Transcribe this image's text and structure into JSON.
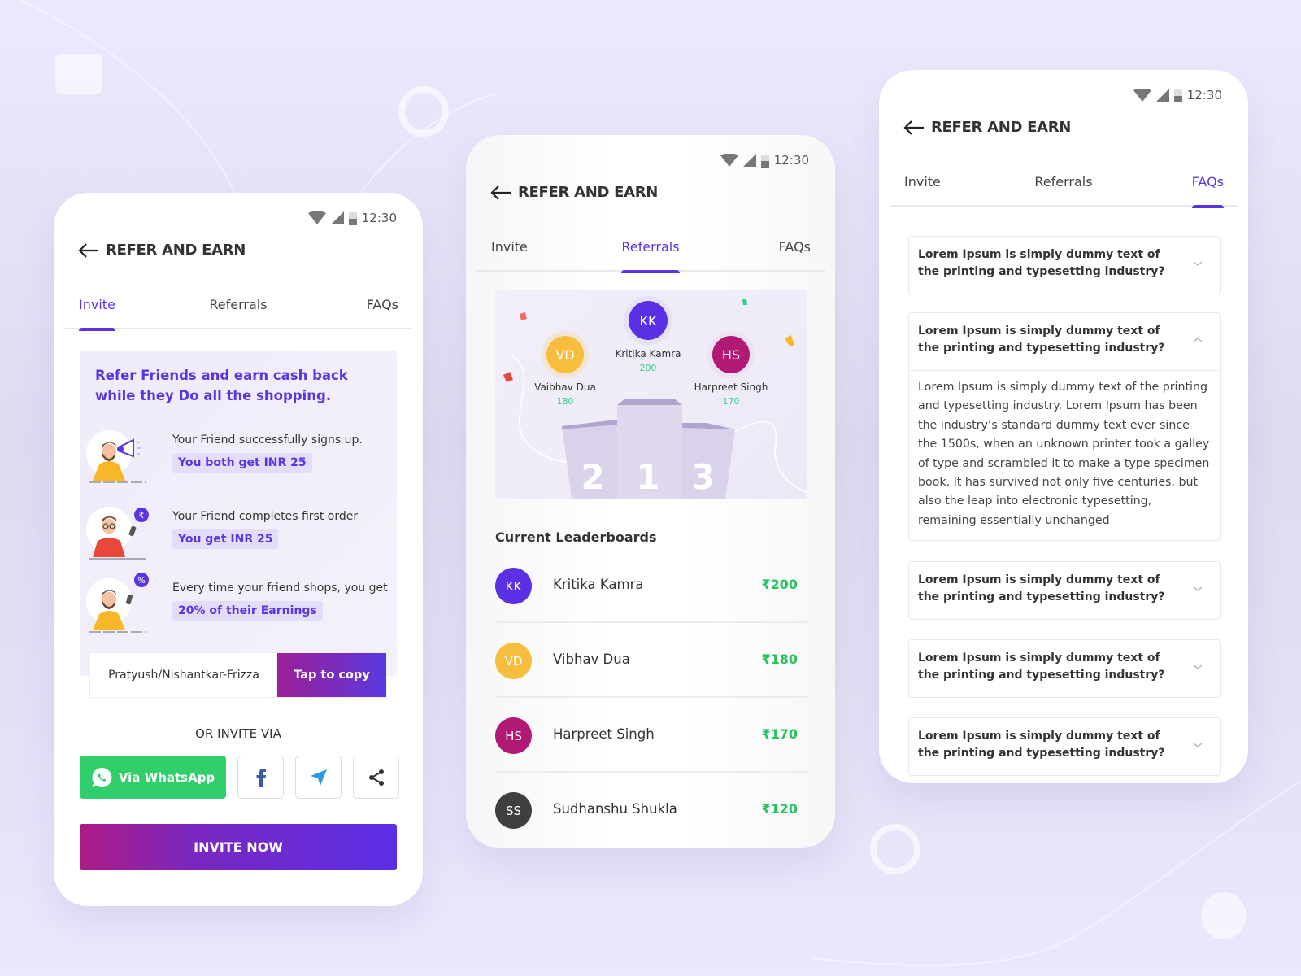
{
  "common": {
    "status_time": "12:30",
    "app_title": "REFER AND EARN",
    "tabs": [
      "Invite",
      "Referrals",
      "FAQs"
    ]
  },
  "colors": {
    "accent": "#5b34e3",
    "success": "#27c35c",
    "whatsapp": "#31cf6b"
  },
  "invite_screen": {
    "active_tab": "Invite",
    "headline": "Refer Friends and earn cash back while they Do all the shopping.",
    "steps": [
      {
        "text": "Your Friend successfully signs up.",
        "reward": "You both get INR 25",
        "icon": "megaphone-person-illustration"
      },
      {
        "text": "Your Friend completes first order",
        "reward": "You get INR 25",
        "icon": "rupee-person-illustration"
      },
      {
        "text": "Every time your friend shops, you get",
        "reward": "20% of their Earnings",
        "icon": "percent-person-illustration"
      }
    ],
    "referral_code": "Pratyush/Nishantkar-Frizza",
    "copy_label": "Tap to copy",
    "or_invite_label": "OR INVITE VIA",
    "whatsapp_label": "Via WhatsApp",
    "share_icons": [
      "facebook-icon",
      "telegram-icon",
      "share-icon"
    ],
    "invite_button": "INVITE NOW"
  },
  "referrals_screen": {
    "active_tab": "Referrals",
    "podium": [
      {
        "rank": "2",
        "initials": "VD",
        "name": "Vaibhav Dua",
        "score": "180",
        "color": "#f7bd3c"
      },
      {
        "rank": "1",
        "initials": "KK",
        "name": "Kritika Kamra",
        "score": "200",
        "color": "#5b2fe3"
      },
      {
        "rank": "3",
        "initials": "HS",
        "name": "Harpreet Singh",
        "score": "170",
        "color": "#b01a74"
      }
    ],
    "leaderboard_title": "Current Leaderboards",
    "leaderboard": [
      {
        "initials": "KK",
        "name": "Kritika Kamra",
        "amount": "₹200",
        "color": "#5b2fe3"
      },
      {
        "initials": "VD",
        "name": "Vibhav Dua",
        "amount": "₹180",
        "color": "#f7bd3c"
      },
      {
        "initials": "HS",
        "name": "Harpreet Singh",
        "amount": "₹170",
        "color": "#b01a74"
      },
      {
        "initials": "SS",
        "name": "Sudhanshu Shukla",
        "amount": "₹120",
        "color": "#3f3f3f"
      }
    ]
  },
  "faqs_screen": {
    "active_tab": "FAQs",
    "items": [
      {
        "question": "Lorem Ipsum is simply dummy text of the printing and typesetting industry?",
        "expanded": false
      },
      {
        "question": "Lorem Ipsum is simply dummy text of the printing and typesetting industry?",
        "expanded": true,
        "answer": "Lorem Ipsum is simply dummy text of the printing and typesetting industry. Lorem Ipsum has been the industry’s standard dummy text ever since the 1500s, when an unknown printer took a galley of type and scrambled it to make a type specimen book. It has survived not only five centuries, but also the leap into electronic typesetting, remaining essentially unchanged"
      },
      {
        "question": "Lorem Ipsum is simply dummy text of the printing and typesetting industry?",
        "expanded": false
      },
      {
        "question": "Lorem Ipsum is simply dummy text of the printing and typesetting industry?",
        "expanded": false
      },
      {
        "question": "Lorem Ipsum is simply dummy text of the printing and typesetting industry?",
        "expanded": false
      }
    ]
  }
}
